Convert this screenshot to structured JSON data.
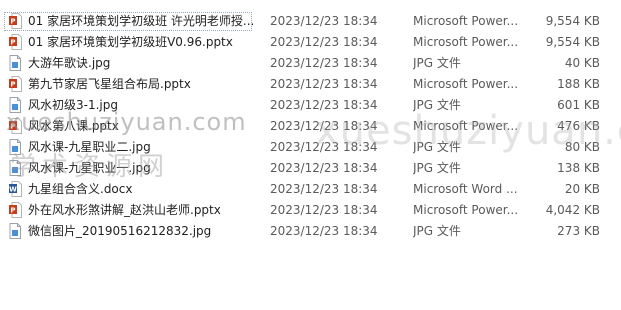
{
  "files": [
    {
      "name": "01 家居环境策划学初级班 许光明老师授...",
      "date": "2023/12/23 18:34",
      "type": "Microsoft Power...",
      "size": "9,554 KB",
      "icon": "pptx-icon",
      "selected": true
    },
    {
      "name": "01 家居环境策划学初级班V0.96.pptx",
      "date": "2023/12/23 18:34",
      "type": "Microsoft Power...",
      "size": "9,554 KB",
      "icon": "pptx-icon"
    },
    {
      "name": "大游年歌诀.jpg",
      "date": "2023/12/23 18:34",
      "type": "JPG 文件",
      "size": "40 KB",
      "icon": "jpg-icon"
    },
    {
      "name": "第九节家居飞星组合布局.pptx",
      "date": "2023/12/23 18:34",
      "type": "Microsoft Power...",
      "size": "188 KB",
      "icon": "pptx-icon"
    },
    {
      "name": "风水初级3-1.jpg",
      "date": "2023/12/23 18:34",
      "type": "JPG 文件",
      "size": "601 KB",
      "icon": "jpg-icon"
    },
    {
      "name": "风水第八课.pptx",
      "date": "2023/12/23 18:34",
      "type": "Microsoft Power...",
      "size": "476 KB",
      "icon": "pptx-icon"
    },
    {
      "name": "风水课-九星职业二.jpg",
      "date": "2023/12/23 18:34",
      "type": "JPG 文件",
      "size": "80 KB",
      "icon": "jpg-icon"
    },
    {
      "name": "风水课-九星职业一.jpg",
      "date": "2023/12/23 18:34",
      "type": "JPG 文件",
      "size": "138 KB",
      "icon": "jpg-icon"
    },
    {
      "name": "九星组合含义.docx",
      "date": "2023/12/23 18:34",
      "type": "Microsoft Word ...",
      "size": "20 KB",
      "icon": "docx-icon"
    },
    {
      "name": "外在风水形煞讲解_赵洪山老师.pptx",
      "date": "2023/12/23 18:34",
      "type": "Microsoft Power...",
      "size": "4,042 KB",
      "icon": "pptx-icon"
    },
    {
      "name": "微信图片_20190516212832.jpg",
      "date": "2023/12/23 18:34",
      "type": "JPG 文件",
      "size": "273 KB",
      "icon": "jpg-icon"
    }
  ],
  "watermarks": {
    "url_left": "xueshuziyuan.com",
    "cn": "学术资源网",
    "url_right": "xueshuziyuan.com"
  },
  "colors": {
    "pptx": "#c43e1c",
    "docx": "#2b579a",
    "jpg": "#4a90d9"
  }
}
